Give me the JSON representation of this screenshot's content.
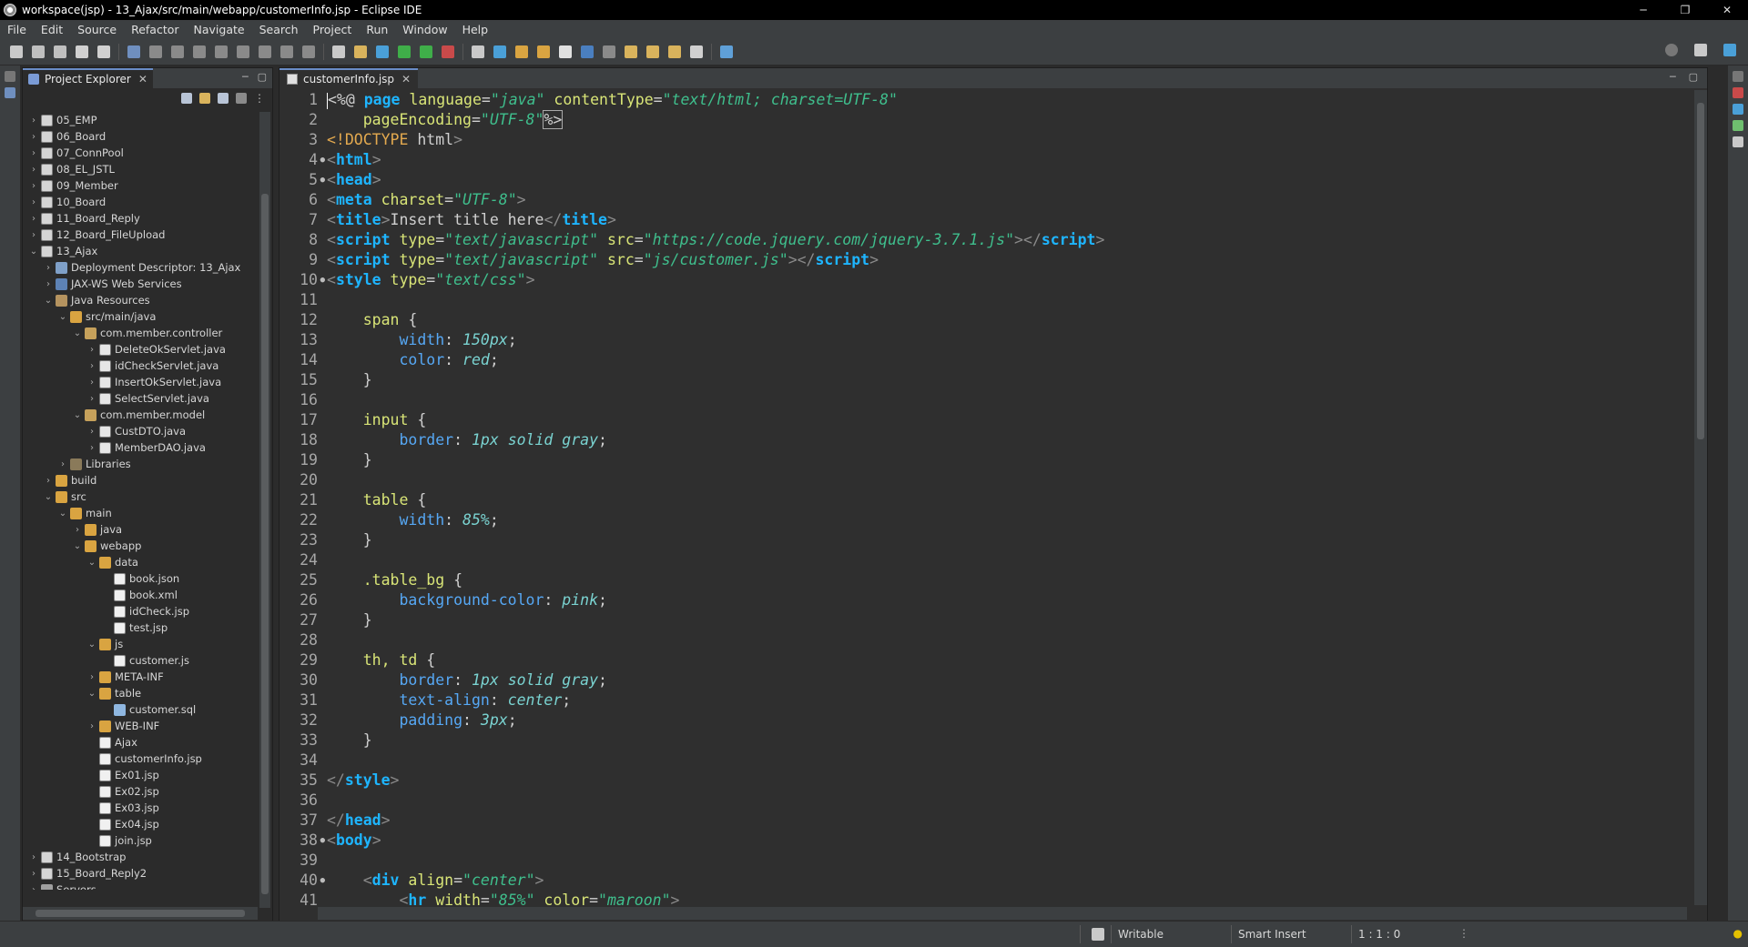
{
  "window": {
    "title": "workspace(jsp) - 13_Ajax/src/main/webapp/customerInfo.jsp - Eclipse IDE",
    "controls": [
      "─",
      "❐",
      "✕"
    ]
  },
  "menu": [
    "File",
    "Edit",
    "Source",
    "Refactor",
    "Navigate",
    "Search",
    "Project",
    "Run",
    "Window",
    "Help"
  ],
  "explorer": {
    "tab_label": "Project Explorer",
    "close": "✕",
    "tree": [
      {
        "label": "05_EMP",
        "icon": "project-icon",
        "chev": "›"
      },
      {
        "label": "06_Board",
        "icon": "project-icon",
        "chev": "›"
      },
      {
        "label": "07_ConnPool",
        "icon": "project-icon",
        "chev": "›"
      },
      {
        "label": "08_EL_JSTL",
        "icon": "project-icon",
        "chev": "›"
      },
      {
        "label": "09_Member",
        "icon": "project-icon",
        "chev": "›"
      },
      {
        "label": "10_Board",
        "icon": "project-icon",
        "chev": "›"
      },
      {
        "label": "11_Board_Reply",
        "icon": "project-icon",
        "chev": "›"
      },
      {
        "label": "12_Board_FileUpload",
        "icon": "project-icon",
        "chev": "›"
      },
      {
        "label": "13_Ajax",
        "icon": "project-icon",
        "chev": "⌄"
      },
      {
        "label": "Deployment Descriptor: 13_Ajax",
        "icon": "deployment-descriptor-icon",
        "chev": "›"
      },
      {
        "label": "JAX-WS Web Services",
        "icon": "web-services-icon",
        "chev": "›"
      },
      {
        "label": "Java Resources",
        "icon": "java-resources-icon",
        "chev": "⌄"
      },
      {
        "label": "src/main/java",
        "icon": "source-folder-icon",
        "chev": "⌄"
      },
      {
        "label": "com.member.controller",
        "icon": "package-icon",
        "chev": "⌄"
      },
      {
        "label": "DeleteOkServlet.java",
        "icon": "java-file-icon",
        "chev": "›"
      },
      {
        "label": "idCheckServlet.java",
        "icon": "java-file-icon",
        "chev": "›"
      },
      {
        "label": "InsertOkServlet.java",
        "icon": "java-file-icon",
        "chev": "›"
      },
      {
        "label": "SelectServlet.java",
        "icon": "java-file-icon",
        "chev": "›"
      },
      {
        "label": "com.member.model",
        "icon": "package-icon",
        "chev": "⌄"
      },
      {
        "label": "CustDTO.java",
        "icon": "java-file-icon",
        "chev": "›"
      },
      {
        "label": "MemberDAO.java",
        "icon": "java-file-icon",
        "chev": "›"
      },
      {
        "label": "Libraries",
        "icon": "libraries-icon",
        "chev": "›"
      },
      {
        "label": "build",
        "icon": "folder-icon",
        "chev": "›"
      },
      {
        "label": "src",
        "icon": "folder-icon",
        "chev": "⌄"
      },
      {
        "label": "main",
        "icon": "folder-icon",
        "chev": "⌄"
      },
      {
        "label": "java",
        "icon": "folder-icon",
        "chev": "›"
      },
      {
        "label": "webapp",
        "icon": "folder-icon",
        "chev": "⌄"
      },
      {
        "label": "data",
        "icon": "folder-icon",
        "chev": "⌄"
      },
      {
        "label": "book.json",
        "icon": "file-icon",
        "chev": ""
      },
      {
        "label": "book.xml",
        "icon": "xml-file-icon",
        "chev": ""
      },
      {
        "label": "idCheck.jsp",
        "icon": "jsp-file-icon",
        "chev": ""
      },
      {
        "label": "test.jsp",
        "icon": "jsp-file-icon",
        "chev": ""
      },
      {
        "label": "js",
        "icon": "folder-icon",
        "chev": "⌄"
      },
      {
        "label": "customer.js",
        "icon": "file-icon",
        "chev": ""
      },
      {
        "label": "META-INF",
        "icon": "folder-icon",
        "chev": "›"
      },
      {
        "label": "table",
        "icon": "folder-icon",
        "chev": "⌄"
      },
      {
        "label": "customer.sql",
        "icon": "sql-file-icon",
        "chev": ""
      },
      {
        "label": "WEB-INF",
        "icon": "folder-icon",
        "chev": "›"
      },
      {
        "label": "Ajax",
        "icon": "file-icon",
        "chev": ""
      },
      {
        "label": "customerInfo.jsp",
        "icon": "jsp-file-icon",
        "chev": ""
      },
      {
        "label": "Ex01.jsp",
        "icon": "jsp-file-icon",
        "chev": ""
      },
      {
        "label": "Ex02.jsp",
        "icon": "jsp-file-icon",
        "chev": ""
      },
      {
        "label": "Ex03.jsp",
        "icon": "jsp-file-icon",
        "chev": ""
      },
      {
        "label": "Ex04.jsp",
        "icon": "jsp-file-icon",
        "chev": ""
      },
      {
        "label": "join.jsp",
        "icon": "jsp-file-icon",
        "chev": ""
      },
      {
        "label": "14_Bootstrap",
        "icon": "project-icon",
        "chev": "›"
      },
      {
        "label": "15_Board_Reply2",
        "icon": "project-icon",
        "chev": "›"
      },
      {
        "label": "Servers",
        "icon": "servers-icon",
        "chev": "›"
      }
    ]
  },
  "editor": {
    "tab_label": "customerInfo.jsp",
    "close": "✕",
    "lines": [
      {
        "n": "1",
        "fold": false,
        "t": [
          [
            "dl",
            "<%@ "
          ],
          [
            "tg",
            "page"
          ],
          [
            "at",
            " language"
          ],
          [
            "dl",
            "="
          ],
          [
            "av",
            "\"java\""
          ],
          [
            "at",
            " contentType"
          ],
          [
            "dl",
            "="
          ],
          [
            "av",
            "\"text/html; charset=UTF-8\""
          ]
        ]
      },
      {
        "n": "2",
        "fold": false,
        "t": [
          [
            "at",
            "    pageEncoding"
          ],
          [
            "dl",
            "="
          ],
          [
            "av",
            "\"UTF-8\""
          ],
          [
            "dl",
            "%>"
          ]
        ]
      },
      {
        "n": "3",
        "fold": false,
        "t": [
          [
            "dir",
            "<!DOCTYPE"
          ],
          [
            "txt",
            " html"
          ],
          [
            "br",
            ">"
          ]
        ]
      },
      {
        "n": "4",
        "fold": true,
        "t": [
          [
            "br",
            "<"
          ],
          [
            "tg",
            "html"
          ],
          [
            "br",
            ">"
          ]
        ]
      },
      {
        "n": "5",
        "fold": true,
        "t": [
          [
            "br",
            "<"
          ],
          [
            "tg",
            "head"
          ],
          [
            "br",
            ">"
          ]
        ]
      },
      {
        "n": "6",
        "fold": false,
        "t": [
          [
            "br",
            "<"
          ],
          [
            "tg",
            "meta"
          ],
          [
            "at",
            " charset"
          ],
          [
            "dl",
            "="
          ],
          [
            "av",
            "\"UTF-8\""
          ],
          [
            "br",
            ">"
          ]
        ]
      },
      {
        "n": "7",
        "fold": false,
        "t": [
          [
            "br",
            "<"
          ],
          [
            "tg",
            "title"
          ],
          [
            "br",
            ">"
          ],
          [
            "txt",
            "Insert title here"
          ],
          [
            "br",
            "</"
          ],
          [
            "tg",
            "title"
          ],
          [
            "br",
            ">"
          ]
        ]
      },
      {
        "n": "8",
        "fold": false,
        "t": [
          [
            "br",
            "<"
          ],
          [
            "tg",
            "script"
          ],
          [
            "at",
            " type"
          ],
          [
            "dl",
            "="
          ],
          [
            "av",
            "\"text/javascript\""
          ],
          [
            "at",
            " src"
          ],
          [
            "dl",
            "="
          ],
          [
            "av",
            "\"https://code.jquery.com/jquery-3.7.1.js\""
          ],
          [
            "br",
            "></"
          ],
          [
            "tg",
            "script"
          ],
          [
            "br",
            ">"
          ]
        ]
      },
      {
        "n": "9",
        "fold": false,
        "t": [
          [
            "br",
            "<"
          ],
          [
            "tg",
            "script"
          ],
          [
            "at",
            " type"
          ],
          [
            "dl",
            "="
          ],
          [
            "av",
            "\"text/javascript\""
          ],
          [
            "at",
            " src"
          ],
          [
            "dl",
            "="
          ],
          [
            "av",
            "\"js/customer.js\""
          ],
          [
            "br",
            "></"
          ],
          [
            "tg",
            "script"
          ],
          [
            "br",
            ">"
          ]
        ]
      },
      {
        "n": "10",
        "fold": true,
        "t": [
          [
            "br",
            "<"
          ],
          [
            "tg",
            "style"
          ],
          [
            "at",
            " type"
          ],
          [
            "dl",
            "="
          ],
          [
            "av",
            "\"text/css\""
          ],
          [
            "br",
            ">"
          ]
        ]
      },
      {
        "n": "11",
        "fold": false,
        "t": []
      },
      {
        "n": "12",
        "fold": false,
        "t": [
          [
            "sel",
            "    span"
          ],
          [
            "dl",
            " {"
          ]
        ]
      },
      {
        "n": "13",
        "fold": false,
        "t": [
          [
            "pr",
            "        width"
          ],
          [
            "dl",
            ": "
          ],
          [
            "pv",
            "150px"
          ],
          [
            "dl",
            ";"
          ]
        ]
      },
      {
        "n": "14",
        "fold": false,
        "t": [
          [
            "pr",
            "        color"
          ],
          [
            "dl",
            ": "
          ],
          [
            "pv",
            "red"
          ],
          [
            "dl",
            ";"
          ]
        ]
      },
      {
        "n": "15",
        "fold": false,
        "t": [
          [
            "dl",
            "    }"
          ]
        ]
      },
      {
        "n": "16",
        "fold": false,
        "t": []
      },
      {
        "n": "17",
        "fold": false,
        "t": [
          [
            "sel",
            "    input"
          ],
          [
            "dl",
            " {"
          ]
        ]
      },
      {
        "n": "18",
        "fold": false,
        "t": [
          [
            "pr",
            "        border"
          ],
          [
            "dl",
            ": "
          ],
          [
            "pv",
            "1px solid gray"
          ],
          [
            "dl",
            ";"
          ]
        ]
      },
      {
        "n": "19",
        "fold": false,
        "t": [
          [
            "dl",
            "    }"
          ]
        ]
      },
      {
        "n": "20",
        "fold": false,
        "t": []
      },
      {
        "n": "21",
        "fold": false,
        "t": [
          [
            "sel",
            "    table"
          ],
          [
            "dl",
            " {"
          ]
        ]
      },
      {
        "n": "22",
        "fold": false,
        "t": [
          [
            "pr",
            "        width"
          ],
          [
            "dl",
            ": "
          ],
          [
            "pv",
            "85%"
          ],
          [
            "dl",
            ";"
          ]
        ]
      },
      {
        "n": "23",
        "fold": false,
        "t": [
          [
            "dl",
            "    }"
          ]
        ]
      },
      {
        "n": "24",
        "fold": false,
        "t": []
      },
      {
        "n": "25",
        "fold": false,
        "t": [
          [
            "sel",
            "    .table_bg"
          ],
          [
            "dl",
            " {"
          ]
        ]
      },
      {
        "n": "26",
        "fold": false,
        "t": [
          [
            "pr",
            "        background-color"
          ],
          [
            "dl",
            ": "
          ],
          [
            "pv",
            "pink"
          ],
          [
            "dl",
            ";"
          ]
        ]
      },
      {
        "n": "27",
        "fold": false,
        "t": [
          [
            "dl",
            "    }"
          ]
        ]
      },
      {
        "n": "28",
        "fold": false,
        "t": []
      },
      {
        "n": "29",
        "fold": false,
        "t": [
          [
            "sel",
            "    th, td"
          ],
          [
            "dl",
            " {"
          ]
        ]
      },
      {
        "n": "30",
        "fold": false,
        "t": [
          [
            "pr",
            "        border"
          ],
          [
            "dl",
            ": "
          ],
          [
            "pv",
            "1px solid gray"
          ],
          [
            "dl",
            ";"
          ]
        ]
      },
      {
        "n": "31",
        "fold": false,
        "t": [
          [
            "pr",
            "        text-align"
          ],
          [
            "dl",
            ": "
          ],
          [
            "pv",
            "center"
          ],
          [
            "dl",
            ";"
          ]
        ]
      },
      {
        "n": "32",
        "fold": false,
        "t": [
          [
            "pr",
            "        padding"
          ],
          [
            "dl",
            ": "
          ],
          [
            "pv",
            "3px"
          ],
          [
            "dl",
            ";"
          ]
        ]
      },
      {
        "n": "33",
        "fold": false,
        "t": [
          [
            "dl",
            "    }"
          ]
        ]
      },
      {
        "n": "34",
        "fold": false,
        "t": []
      },
      {
        "n": "35",
        "fold": false,
        "t": [
          [
            "br",
            "</"
          ],
          [
            "tg",
            "style"
          ],
          [
            "br",
            ">"
          ]
        ]
      },
      {
        "n": "36",
        "fold": false,
        "t": []
      },
      {
        "n": "37",
        "fold": false,
        "t": [
          [
            "br",
            "</"
          ],
          [
            "tg",
            "head"
          ],
          [
            "br",
            ">"
          ]
        ]
      },
      {
        "n": "38",
        "fold": true,
        "t": [
          [
            "br",
            "<"
          ],
          [
            "tg",
            "body"
          ],
          [
            "br",
            ">"
          ]
        ]
      },
      {
        "n": "39",
        "fold": false,
        "t": []
      },
      {
        "n": "40",
        "fold": true,
        "t": [
          [
            "br",
            "    <"
          ],
          [
            "tg",
            "div"
          ],
          [
            "at",
            " align"
          ],
          [
            "dl",
            "="
          ],
          [
            "av",
            "\"center\""
          ],
          [
            "br",
            ">"
          ]
        ]
      },
      {
        "n": "41",
        "fold": false,
        "t": [
          [
            "br",
            "        <"
          ],
          [
            "tg",
            "hr"
          ],
          [
            "at",
            " width"
          ],
          [
            "dl",
            "="
          ],
          [
            "av",
            "\"85%\""
          ],
          [
            "at",
            " color"
          ],
          [
            "dl",
            "="
          ],
          [
            "av",
            "\"maroon\""
          ],
          [
            "br",
            ">"
          ]
        ]
      }
    ]
  },
  "status": {
    "writable": "Writable",
    "insert_mode": "Smart Insert",
    "position": "1 : 1 : 0"
  },
  "colors": {
    "tag": "#1eb5ff",
    "attribute": "#d9e577",
    "attr_value": "#3fbf8d",
    "css_property": "#56a8f5",
    "css_value": "#7ad3d1",
    "background": "#2f2f2f"
  }
}
